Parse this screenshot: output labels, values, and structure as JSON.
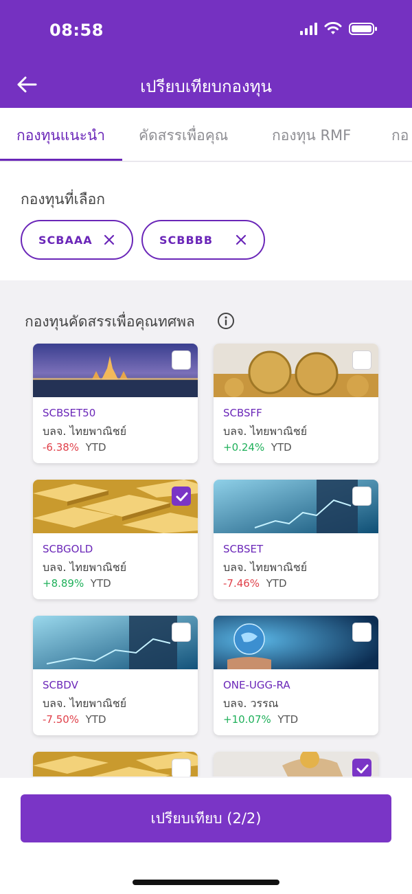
{
  "status_bar": {
    "time": "08:58"
  },
  "header": {
    "title": "เปรียบเทียบกองทุน",
    "back_icon": "arrow-left-icon"
  },
  "tabs": [
    {
      "label": "กองทุนแนะนำ",
      "active": true
    },
    {
      "label": "คัดสรรเพื่อคุณ",
      "active": false
    },
    {
      "label": "กองทุน RMF",
      "active": false
    },
    {
      "label": "กอ",
      "active": false
    }
  ],
  "selected": {
    "title": "กองทุนที่เลือก",
    "chips": [
      {
        "label": "SCBAAA"
      },
      {
        "label": "SCBBBB"
      }
    ]
  },
  "list": {
    "title": "กองทุนคัดสรรเพื่อคุณทศพล",
    "funds": [
      {
        "code": "SCBSET50",
        "manager": "บลจ. ไทยพาณิชย์",
        "return": "-6.38%",
        "period": "YTD",
        "checked": false
      },
      {
        "code": "SCBSFF",
        "manager": "บลจ. ไทยพาณิชย์",
        "return": "+0.24%",
        "period": "YTD",
        "checked": false
      },
      {
        "code": "SCBGOLD",
        "manager": "บลจ. ไทยพาณิชย์",
        "return": "+8.89%",
        "period": "YTD",
        "checked": true
      },
      {
        "code": "SCBSET",
        "manager": "บลจ. ไทยพาณิชย์",
        "return": "-7.46%",
        "period": "YTD",
        "checked": false
      },
      {
        "code": "SCBDV",
        "manager": "บลจ. ไทยพาณิชย์",
        "return": "-7.50%",
        "period": "YTD",
        "checked": false
      },
      {
        "code": "ONE-UGG-RA",
        "manager": "บลจ. วรรณ",
        "return": "+10.07%",
        "period": "YTD",
        "checked": false
      },
      {
        "code": "",
        "manager": "",
        "return": "",
        "period": "",
        "checked": false
      },
      {
        "code": "",
        "manager": "",
        "return": "",
        "period": "",
        "checked": true
      }
    ]
  },
  "footer": {
    "compare_label": "เปรียบเทียบ (2/2)"
  },
  "colors": {
    "brand": "#7531c1",
    "accent": "#6a26b8",
    "positive": "#1fb05a",
    "negative": "#e0404a"
  }
}
